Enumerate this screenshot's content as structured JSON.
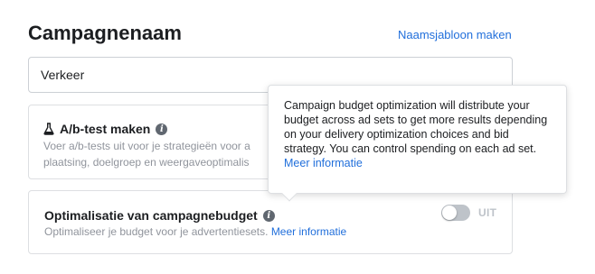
{
  "header": {
    "title": "Campagnenaam",
    "name_template_link": "Naamsjabloon maken"
  },
  "campaign_name": {
    "value": "Verkeer"
  },
  "ab_test": {
    "title": "A/b-test maken",
    "description_line1": "Voer a/b-tests uit voor je strategieën voor a",
    "description_line2": "plaatsing, doelgroep en weergaveoptimalis"
  },
  "cbo": {
    "title": "Optimalisatie van campagnebudget",
    "description": "Optimaliseer je budget voor je advertentiesets.",
    "learn_more": "Meer informatie",
    "toggle_label": "UIT",
    "toggle_on": false
  },
  "tooltip": {
    "text": "Campaign budget optimization will distribute your budget across ad sets to get more results depending on your delivery optimization choices and bid strategy. You can control spending on each ad set.",
    "learn_more": "Meer informatie"
  },
  "icons": {
    "info": "info-icon",
    "flask": "flask-icon"
  }
}
